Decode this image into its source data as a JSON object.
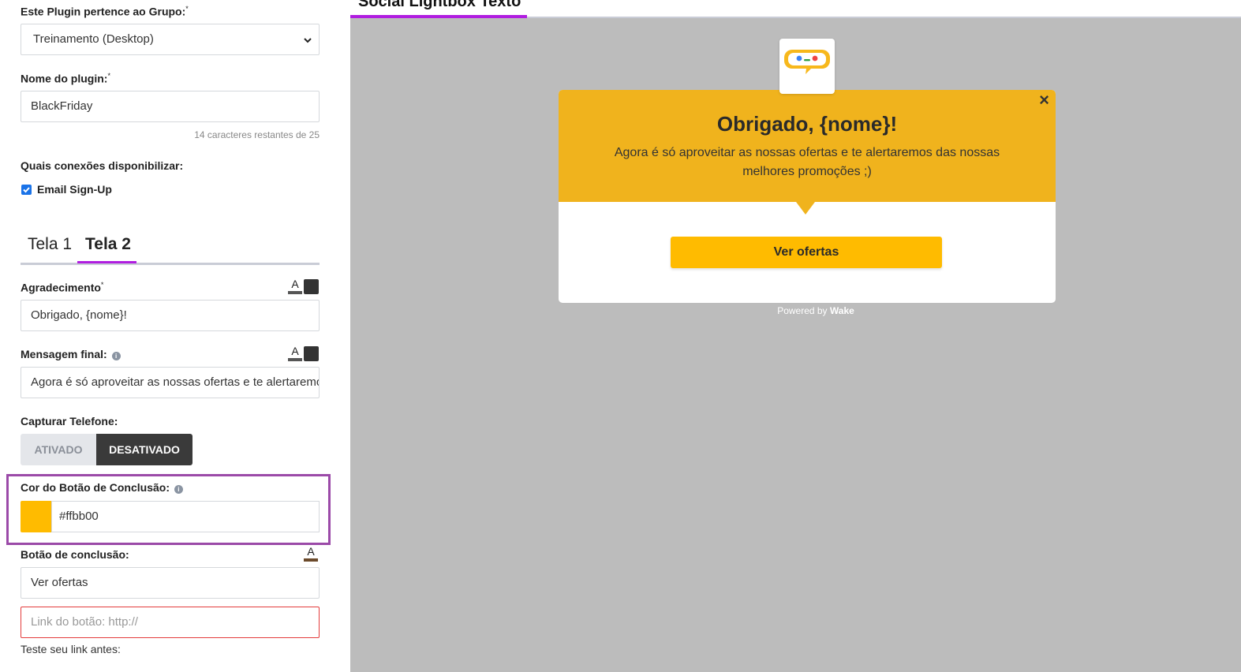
{
  "form": {
    "group_label": "Este Plugin pertence ao Grupo:",
    "group_value": "Treinamento (Desktop)",
    "name_label": "Nome do plugin:",
    "name_value": "BlackFriday",
    "name_hint": "14 caracteres restantes de 25",
    "connections_label": "Quais conexões disponibilizar:",
    "connection_email": "Email Sign-Up",
    "required_mark": "*"
  },
  "tabs": [
    "Tela 1",
    "Tela 2"
  ],
  "screen2": {
    "thanks_label": "Agradecimento",
    "thanks_value": "Obrigado, {nome}!",
    "final_msg_label": "Mensagem final:",
    "final_msg_value": "Agora é só aproveitar as nossas ofertas e te alertaremos das nossas melhores promoções ;)",
    "phone_label": "Capturar Telefone:",
    "phone_on": "ATIVADO",
    "phone_off": "DESATIVADO",
    "btn_color_label": "Cor do Botão de Conclusão:",
    "btn_color_value": "#ffbb00",
    "finish_btn_label": "Botão de conclusão:",
    "finish_btn_value": "Ver ofertas",
    "link_placeholder": "Link do botão: http://",
    "test_link": "Teste seu link antes:"
  },
  "preview": {
    "title": "Social Lightbox Texto",
    "heading": "Obrigado, {nome}!",
    "message": "Agora é só aproveitar as nossas ofertas e te alertaremos das nossas melhores promoções ;)",
    "button": "Ver ofertas",
    "powered_prefix": "Powered by ",
    "powered_brand": "Wake",
    "close": "×",
    "header_color": "#f0b31d",
    "button_color": "#ffbb00"
  },
  "icons": {
    "format_text": "A",
    "info": "i",
    "chevron": "⌄",
    "check": "✓"
  }
}
